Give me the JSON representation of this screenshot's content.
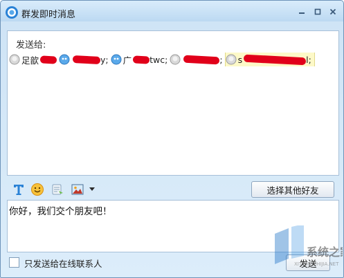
{
  "window": {
    "title": "群发即时消息",
    "controls": [
      "minimize",
      "maximize",
      "close"
    ]
  },
  "recipients": {
    "label": "发送给:",
    "items": [
      {
        "name": "足歆",
        "suffix": "",
        "avatar": "gray-avatar-icon",
        "redacted": true,
        "selected": false
      },
      {
        "name": "",
        "suffix": "y;",
        "avatar": "blue-avatar-icon",
        "redacted": true,
        "selected": false
      },
      {
        "name": "广",
        "suffix": "twc;",
        "avatar": "blue-avatar-icon",
        "redacted": true,
        "selected": false
      },
      {
        "name": "",
        "suffix": ";",
        "avatar": "gray-avatar-icon",
        "redacted": true,
        "selected": false
      },
      {
        "name": "s",
        "suffix": "l;",
        "avatar": "gray-avatar-icon",
        "redacted": true,
        "selected": true
      }
    ]
  },
  "toolbar": {
    "icons": [
      "font-icon",
      "emoji-icon",
      "shake-icon",
      "image-icon",
      "dropdown-arrow-icon"
    ],
    "choose_friends_label": "选择其他好友"
  },
  "message": {
    "text": "你好，我们交个朋友吧！"
  },
  "footer": {
    "online_only_label": "只发送给在线联系人",
    "online_only_checked": false,
    "send_label": "发送"
  },
  "watermark": {
    "text": "系统之家",
    "url": "XITONGZHIJIA.NET"
  },
  "colors": {
    "accent": "#2a82d6",
    "redaction": "#e1001a",
    "panel_border": "#a6bfd8"
  }
}
